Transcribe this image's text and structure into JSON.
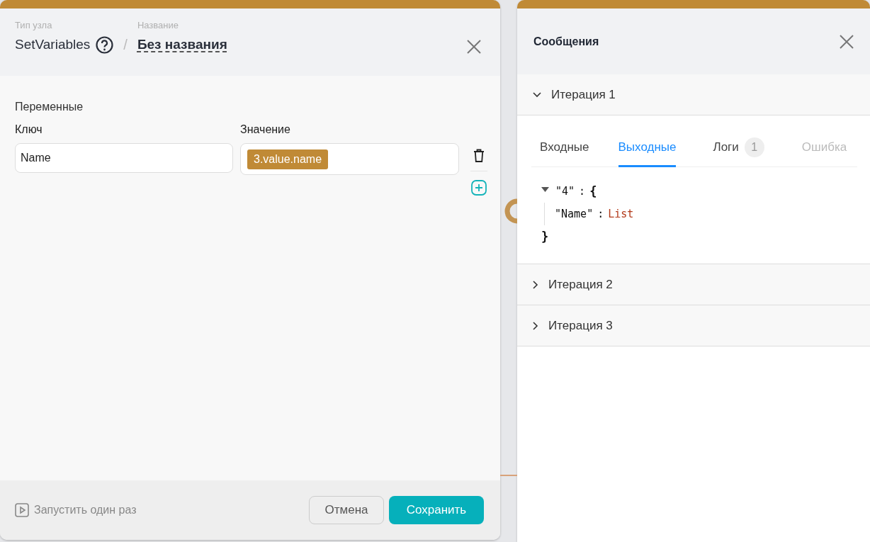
{
  "node_editor": {
    "node_type_label": "Тип узла",
    "node_type": "SetVariables",
    "separator": "/",
    "name_label": "Название",
    "name": "Без названия",
    "section_title": "Переменные",
    "columns": [
      "Ключ",
      "Значение"
    ],
    "variables": [
      {
        "key": "Name",
        "value": "3.value.name"
      }
    ],
    "footer": {
      "run_once": "Запустить один раз",
      "buttons": [
        {
          "label": "Отмена",
          "kind": "secondary"
        },
        {
          "label": "Сохранить",
          "kind": "primary"
        }
      ]
    }
  },
  "messages_panel": {
    "title": "Сообщения",
    "iterations": [
      {
        "label": "Итерация 1",
        "expanded": true,
        "tabs": [
          {
            "label": "Входные",
            "selected": false,
            "disabled": false
          },
          {
            "label": "Выходные",
            "selected": true,
            "disabled": false
          },
          {
            "label": "Логи",
            "badge": "1",
            "selected": false,
            "disabled": false
          },
          {
            "label": "Ошибка",
            "selected": false,
            "disabled": true
          }
        ],
        "output": {
          "key": "\"4\"",
          "colon": ":",
          "open": "{",
          "close": "}",
          "children": [
            {
              "key": "\"Name\"",
              "colon": ":",
              "value": "List"
            }
          ]
        }
      },
      {
        "label": "Итерация 2",
        "expanded": false
      },
      {
        "label": "Итерация 3",
        "expanded": false
      }
    ]
  }
}
